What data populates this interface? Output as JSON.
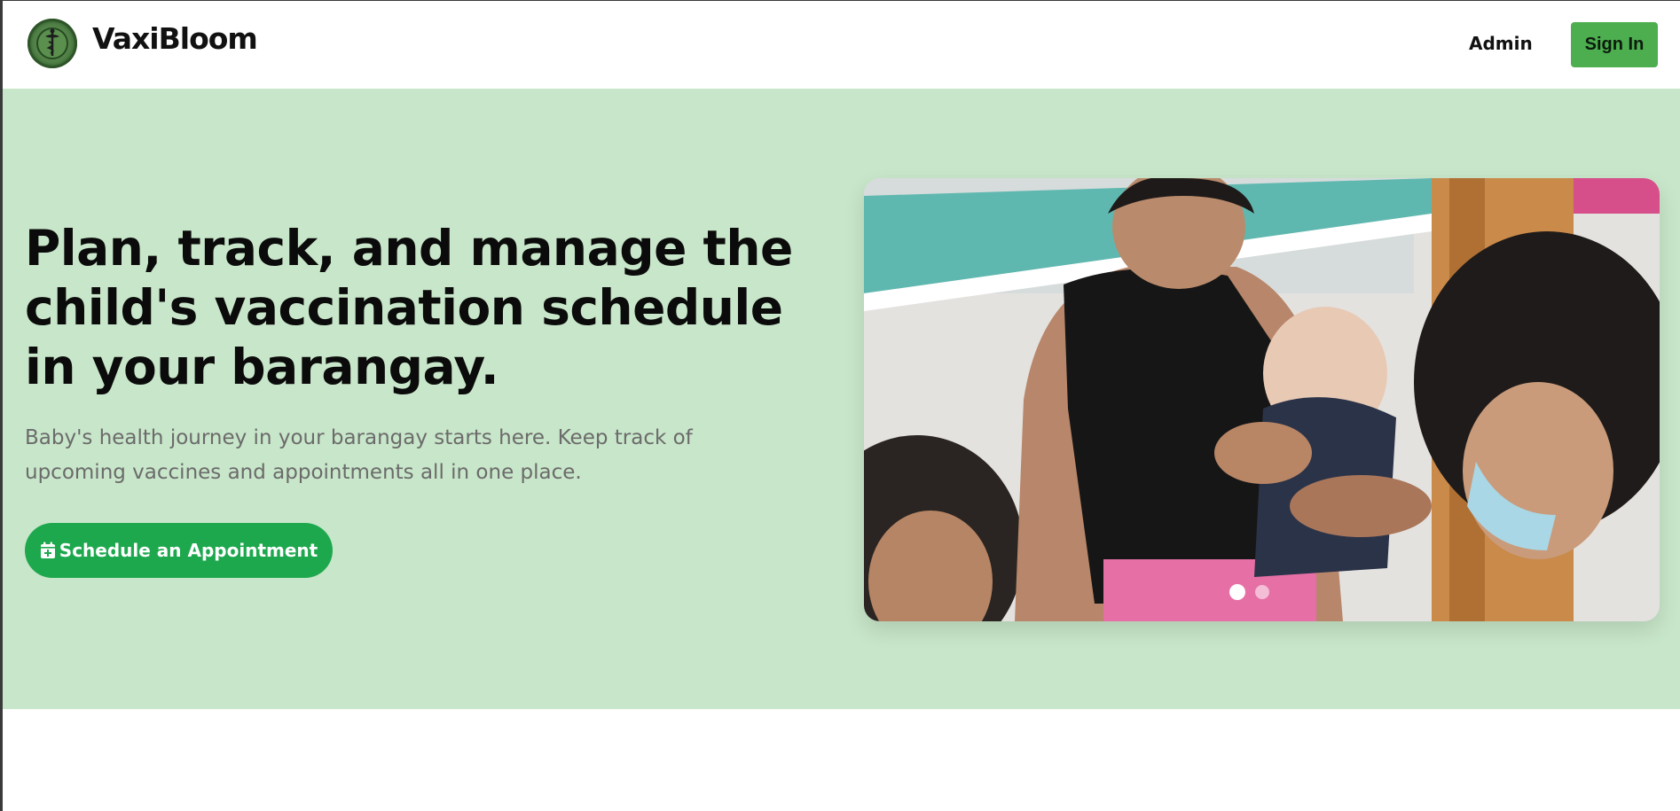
{
  "header": {
    "brand_name": "VaxiBloom",
    "logo_icon": "health-center-seal-logo",
    "nav_admin": "Admin",
    "sign_in_label": "Sign In"
  },
  "hero": {
    "title": "Plan, track, and manage the child's vaccination schedule in your barangay.",
    "subtitle": "Baby's health journey in your barangay starts here. Keep track of upcoming vaccines and appointments all in one place.",
    "cta_label": "Schedule an Appointment",
    "cta_icon": "calendar-plus-icon"
  },
  "carousel": {
    "slide_count": 2,
    "active_slide": 1,
    "image_description_icon": "vaccination-photo"
  },
  "colors": {
    "hero_bg": "#c8e6c9",
    "primary_green": "#4cae4f",
    "cta_green": "#1ea84e"
  }
}
